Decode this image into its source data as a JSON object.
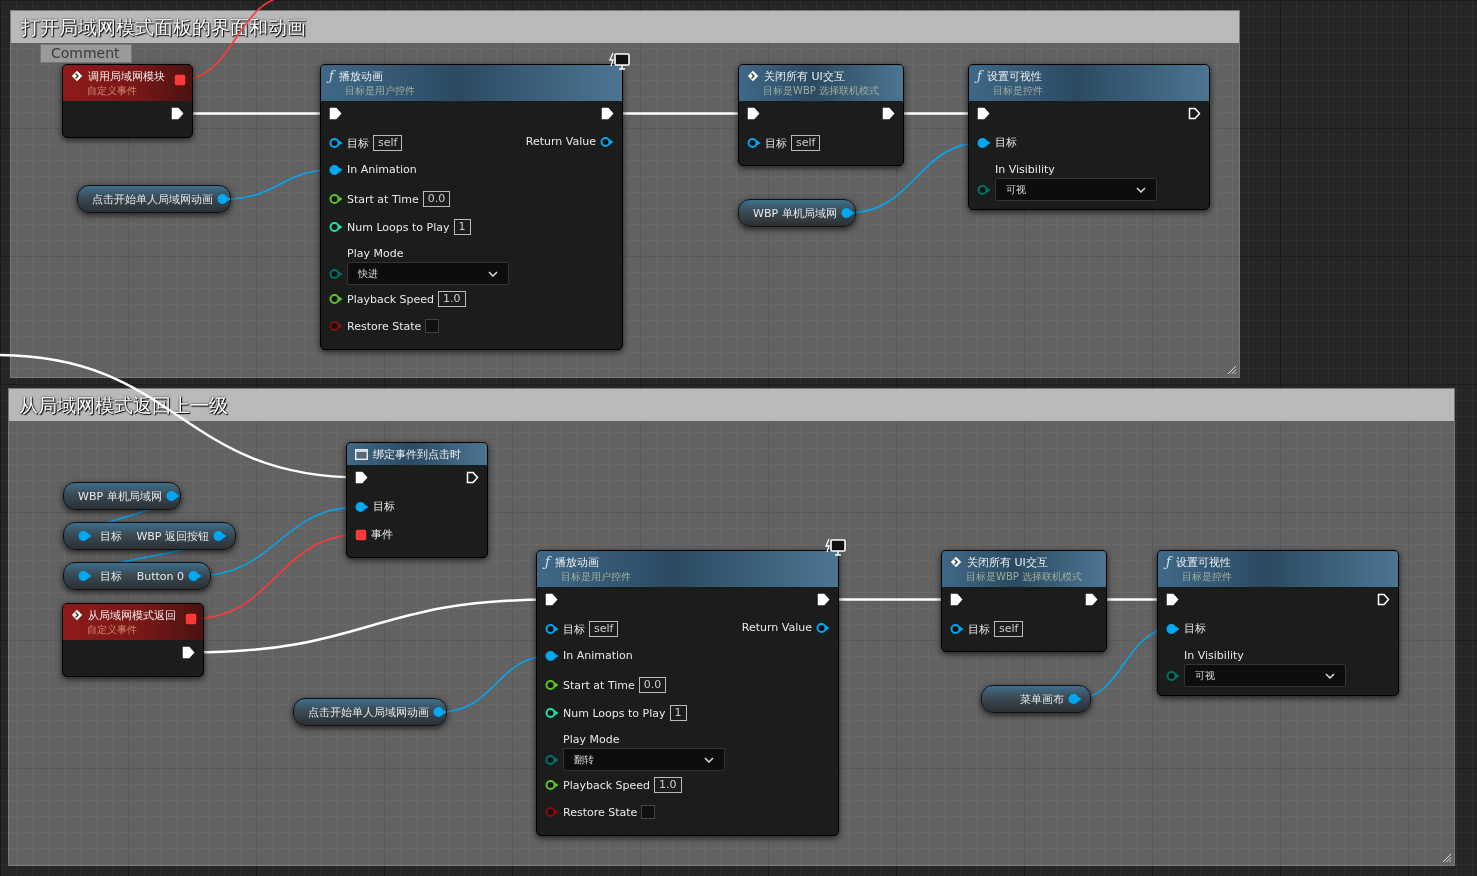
{
  "comment_boxes": [
    {
      "title": "打开局域网模式面板的界面和动画"
    },
    {
      "title": "从局域网模式返回上一级"
    }
  ],
  "collapsed_comment": {
    "title": "Comment"
  },
  "nodes": [
    {
      "kind": "event",
      "icon": {
        "kind": "diamond"
      },
      "title": "调用局域网模块",
      "subtitle": "自定义事件",
      "header_pin": {
        "kind": "delegate",
        "connected": true
      },
      "rows": [
        {
          "right": {
            "kind": "exec",
            "connected": true
          }
        }
      ]
    },
    {
      "kind": "variable",
      "rows": [
        {
          "right": {
            "kind": "object",
            "label": "点击开始单人局域网动画",
            "connected": true
          }
        }
      ]
    },
    {
      "kind": "function",
      "icon": {
        "kind": "glyph",
        "text": "ƒ"
      },
      "title": "播放动画",
      "subtitle": "目标是用户控件",
      "network_badge": true,
      "rows": [
        {
          "left": {
            "kind": "exec",
            "connected": true
          },
          "right": {
            "kind": "exec",
            "connected": true
          }
        },
        {
          "left": {
            "kind": "object",
            "label": "目标",
            "connected": false,
            "value": "self"
          },
          "right": {
            "kind": "object",
            "label": "Return Value",
            "connected": false
          }
        },
        {
          "left": {
            "kind": "object",
            "label": "In Animation",
            "connected": true
          }
        },
        {
          "left": {
            "kind": "float",
            "label": "Start at Time",
            "connected": false,
            "value": "0.0"
          }
        },
        {
          "left": {
            "kind": "int",
            "label": "Num Loops to Play",
            "connected": false,
            "value": "1"
          }
        },
        {
          "left": {
            "kind": "byte",
            "label": "Play Mode",
            "connected": false,
            "selection": "快进"
          }
        },
        {
          "left": {
            "kind": "float",
            "label": "Playback Speed",
            "connected": false,
            "value": "1.0"
          }
        },
        {
          "left": {
            "kind": "bool",
            "label": "Restore State",
            "connected": false,
            "checked": false
          }
        }
      ]
    },
    {
      "kind": "function",
      "icon": {
        "kind": "diamond"
      },
      "title": "关闭所有 UI交互",
      "subtitle": "目标是WBP 选择联机模式",
      "rows": [
        {
          "left": {
            "kind": "exec",
            "connected": true
          },
          "right": {
            "kind": "exec",
            "connected": true
          }
        },
        {
          "left": {
            "kind": "object",
            "label": "目标",
            "connected": false,
            "value": "self"
          }
        }
      ]
    },
    {
      "kind": "variable",
      "rows": [
        {
          "right": {
            "kind": "object",
            "label": "WBP 单机局域网",
            "connected": true
          }
        }
      ]
    },
    {
      "kind": "function",
      "icon": {
        "kind": "glyph",
        "text": "ƒ"
      },
      "title": "设置可视性",
      "subtitle": "目标是控件",
      "rows": [
        {
          "left": {
            "kind": "exec",
            "connected": true
          },
          "right": {
            "kind": "exec",
            "connected": false
          }
        },
        {
          "left": {
            "kind": "object",
            "label": "目标",
            "connected": true
          }
        },
        {
          "left": {
            "kind": "byte",
            "label": "In Visibility",
            "connected": false,
            "selection": "可视"
          }
        }
      ]
    },
    {
      "kind": "variable",
      "rows": [
        {
          "right": {
            "kind": "object",
            "label": "WBP 单机局域网",
            "connected": true
          }
        }
      ]
    },
    {
      "kind": "variable",
      "rows": [
        {
          "left": {
            "kind": "object",
            "label": "目标",
            "connected": true
          },
          "right": {
            "kind": "object",
            "label": "WBP 返回按钮",
            "connected": true
          }
        }
      ]
    },
    {
      "kind": "variable",
      "rows": [
        {
          "left": {
            "kind": "object",
            "label": "目标",
            "connected": true
          },
          "right": {
            "kind": "object",
            "label": "Button 0",
            "connected": true
          }
        }
      ]
    },
    {
      "kind": "event",
      "icon": {
        "kind": "diamond"
      },
      "title": "从局域网模式返回",
      "subtitle": "自定义事件",
      "header_pin": {
        "kind": "delegate",
        "connected": true
      },
      "rows": [
        {
          "right": {
            "kind": "exec",
            "connected": true
          }
        }
      ]
    },
    {
      "kind": "variable",
      "rows": [
        {
          "right": {
            "kind": "object",
            "label": "点击开始单人局域网动画",
            "connected": true
          }
        }
      ]
    },
    {
      "kind": "bind",
      "icon": {
        "kind": "window"
      },
      "title": "绑定事件到点击时",
      "rows": [
        {
          "left": {
            "kind": "exec",
            "connected": true
          },
          "right": {
            "kind": "exec",
            "connected": false
          }
        },
        {
          "left": {
            "kind": "object",
            "label": "目标",
            "connected": true
          }
        },
        {
          "left": {
            "kind": "delegate",
            "label": "事件",
            "connected": true
          }
        }
      ]
    },
    {
      "kind": "function",
      "icon": {
        "kind": "glyph",
        "text": "ƒ"
      },
      "title": "播放动画",
      "subtitle": "目标是用户控件",
      "network_badge": true,
      "rows": [
        {
          "left": {
            "kind": "exec",
            "connected": true
          },
          "right": {
            "kind": "exec",
            "connected": true
          }
        },
        {
          "left": {
            "kind": "object",
            "label": "目标",
            "connected": false,
            "value": "self"
          },
          "right": {
            "kind": "object",
            "label": "Return Value",
            "connected": false
          }
        },
        {
          "left": {
            "kind": "object",
            "label": "In Animation",
            "connected": true
          }
        },
        {
          "left": {
            "kind": "float",
            "label": "Start at Time",
            "connected": false,
            "value": "0.0"
          }
        },
        {
          "left": {
            "kind": "int",
            "label": "Num Loops to Play",
            "connected": false,
            "value": "1"
          }
        },
        {
          "left": {
            "kind": "byte",
            "label": "Play Mode",
            "connected": false,
            "selection": "翻转"
          }
        },
        {
          "left": {
            "kind": "float",
            "label": "Playback Speed",
            "connected": false,
            "value": "1.0"
          }
        },
        {
          "left": {
            "kind": "bool",
            "label": "Restore State",
            "connected": false,
            "checked": false
          }
        }
      ]
    },
    {
      "kind": "function",
      "icon": {
        "kind": "diamond"
      },
      "title": "关闭所有 UI交互",
      "subtitle": "目标是WBP 选择联机模式",
      "rows": [
        {
          "left": {
            "kind": "exec",
            "connected": true
          },
          "right": {
            "kind": "exec",
            "connected": true
          }
        },
        {
          "left": {
            "kind": "object",
            "label": "目标",
            "connected": false,
            "value": "self"
          }
        }
      ]
    },
    {
      "kind": "variable",
      "rows": [
        {
          "right": {
            "kind": "object",
            "label": "菜单画布",
            "connected": true
          }
        }
      ]
    },
    {
      "kind": "function",
      "icon": {
        "kind": "glyph",
        "text": "ƒ"
      },
      "title": "设置可视性",
      "subtitle": "目标是控件",
      "rows": [
        {
          "left": {
            "kind": "exec",
            "connected": true
          },
          "right": {
            "kind": "exec",
            "connected": false
          }
        },
        {
          "left": {
            "kind": "object",
            "label": "目标",
            "connected": true
          }
        },
        {
          "left": {
            "kind": "byte",
            "label": "In Visibility",
            "connected": false,
            "selection": "可视"
          }
        }
      ]
    }
  ]
}
